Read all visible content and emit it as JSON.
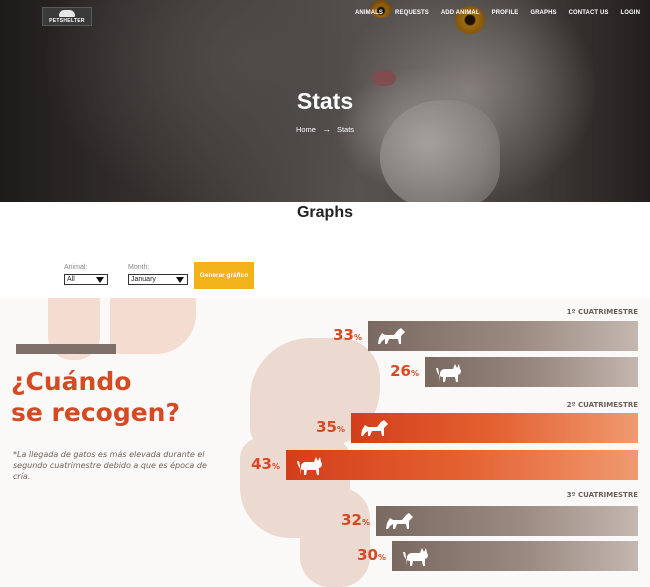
{
  "header": {
    "logo_text": "PETSHELTER",
    "nav": [
      "ANIMALS",
      "REQUESTS",
      "ADD ANIMAL",
      "PROFILE",
      "GRAPHS",
      "CONTACT US",
      "LOGIN"
    ]
  },
  "hero": {
    "title": "Stats",
    "breadcrumb": {
      "home": "Home",
      "separator": "→",
      "current": "Stats"
    }
  },
  "section": {
    "title": "Graphs"
  },
  "filters": {
    "animal": {
      "label": "Animal:",
      "value": "All"
    },
    "month": {
      "label": "Month:",
      "value": "January"
    },
    "button_label": "Generar gráfico"
  },
  "infographic": {
    "headline_line1": "¿Cuándo",
    "headline_line2": "se recogen?",
    "note": "*La llegada de gatos es más elevada durante el segundo cuatrimestre debido a que es época de cría.",
    "colors": {
      "accent": "#d64a23",
      "gray_bar": "#7a6960",
      "orange_bar": "#e05a2c"
    }
  },
  "chart_data": {
    "type": "bar",
    "groups": [
      {
        "label": "1º CUATRIMESTRE",
        "bars": [
          {
            "animal": "dog",
            "value": 33,
            "unit": "%"
          },
          {
            "animal": "cat",
            "value": 26,
            "unit": "%"
          }
        ]
      },
      {
        "label": "2º CUATRIMESTRE",
        "bars": [
          {
            "animal": "dog",
            "value": 35,
            "unit": "%"
          },
          {
            "animal": "cat",
            "value": 43,
            "unit": "%"
          }
        ]
      },
      {
        "label": "3º CUATRIMESTRE",
        "bars": [
          {
            "animal": "dog",
            "value": 32,
            "unit": "%"
          },
          {
            "animal": "cat",
            "value": 30,
            "unit": "%"
          }
        ]
      }
    ],
    "highlighted_group": 1
  }
}
